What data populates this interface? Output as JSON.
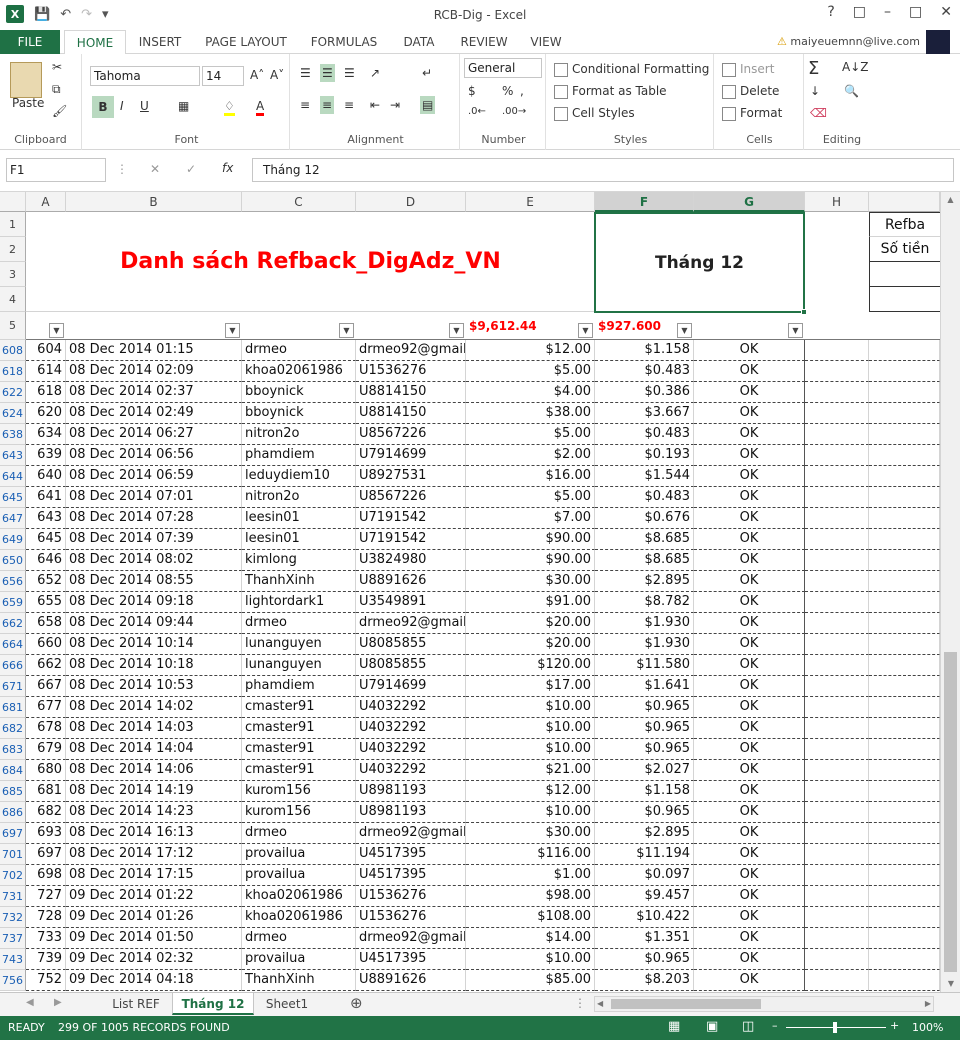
{
  "window": {
    "title": "RCB-Dig - Excel",
    "user": "maiyeuemnn@live.com"
  },
  "tabs": [
    "FILE",
    "HOME",
    "INSERT",
    "PAGE LAYOUT",
    "FORMULAS",
    "DATA",
    "REVIEW",
    "VIEW"
  ],
  "ribbon": {
    "clipboard": {
      "label": "Clipboard",
      "paste": "Paste"
    },
    "font": {
      "label": "Font",
      "name": "Tahoma",
      "size": "14"
    },
    "alignment": {
      "label": "Alignment"
    },
    "number": {
      "label": "Number",
      "format": "General"
    },
    "styles": {
      "label": "Styles",
      "conditional": "Conditional Formatting",
      "format_table": "Format as Table",
      "cell_styles": "Cell Styles"
    },
    "cells": {
      "label": "Cells",
      "insert": "Insert",
      "delete": "Delete",
      "format": "Format"
    },
    "editing": {
      "label": "Editing"
    }
  },
  "formula_bar": {
    "name_box": "F1",
    "content": "Tháng 12"
  },
  "columns": [
    "A",
    "B",
    "C",
    "D",
    "E",
    "F",
    "G",
    "H"
  ],
  "header": {
    "title": "Danh sách Refback_DigAdz_VN",
    "month": "Tháng 12",
    "side_label_1": "Refba",
    "side_label_2": "Số tiền",
    "total_e": "$9,612.44",
    "total_f": "$927.600"
  },
  "top_row_numbers": [
    "1",
    "2",
    "3",
    "4",
    "5"
  ],
  "rows": [
    {
      "r": "608",
      "a": "604",
      "b": "08 Dec 2014 01:15",
      "c": "drmeo",
      "d": "drmeo92@gmail",
      "e": "$12.00",
      "f": "$1.158",
      "g": "OK"
    },
    {
      "r": "618",
      "a": "614",
      "b": "08 Dec 2014 02:09",
      "c": "khoa02061986",
      "d": "U1536276",
      "e": "$5.00",
      "f": "$0.483",
      "g": "OK"
    },
    {
      "r": "622",
      "a": "618",
      "b": "08 Dec 2014 02:37",
      "c": "bboynick",
      "d": "U8814150",
      "e": "$4.00",
      "f": "$0.386",
      "g": "OK"
    },
    {
      "r": "624",
      "a": "620",
      "b": "08 Dec 2014 02:49",
      "c": "bboynick",
      "d": "U8814150",
      "e": "$38.00",
      "f": "$3.667",
      "g": "OK"
    },
    {
      "r": "638",
      "a": "634",
      "b": "08 Dec 2014 06:27",
      "c": "nitron2o",
      "d": "U8567226",
      "e": "$5.00",
      "f": "$0.483",
      "g": "OK"
    },
    {
      "r": "643",
      "a": "639",
      "b": "08 Dec 2014 06:56",
      "c": "phamdiem",
      "d": "U7914699",
      "e": "$2.00",
      "f": "$0.193",
      "g": "OK"
    },
    {
      "r": "644",
      "a": "640",
      "b": "08 Dec 2014 06:59",
      "c": "leduydiem10",
      "d": "U8927531",
      "e": "$16.00",
      "f": "$1.544",
      "g": "OK"
    },
    {
      "r": "645",
      "a": "641",
      "b": "08 Dec 2014 07:01",
      "c": "nitron2o",
      "d": "U8567226",
      "e": "$5.00",
      "f": "$0.483",
      "g": "OK"
    },
    {
      "r": "647",
      "a": "643",
      "b": "08 Dec 2014 07:28",
      "c": "leesin01",
      "d": "U7191542",
      "e": "$7.00",
      "f": "$0.676",
      "g": "OK"
    },
    {
      "r": "649",
      "a": "645",
      "b": "08 Dec 2014 07:39",
      "c": "leesin01",
      "d": "U7191542",
      "e": "$90.00",
      "f": "$8.685",
      "g": "OK"
    },
    {
      "r": "650",
      "a": "646",
      "b": "08 Dec 2014 08:02",
      "c": "kimlong",
      "d": "U3824980",
      "e": "$90.00",
      "f": "$8.685",
      "g": "OK"
    },
    {
      "r": "656",
      "a": "652",
      "b": "08 Dec 2014 08:55",
      "c": "ThanhXinh",
      "d": "U8891626",
      "e": "$30.00",
      "f": "$2.895",
      "g": "OK"
    },
    {
      "r": "659",
      "a": "655",
      "b": "08 Dec 2014 09:18",
      "c": "lightordark1",
      "d": "U3549891",
      "e": "$91.00",
      "f": "$8.782",
      "g": "OK"
    },
    {
      "r": "662",
      "a": "658",
      "b": "08 Dec 2014 09:44",
      "c": "drmeo",
      "d": "drmeo92@gmail",
      "e": "$20.00",
      "f": "$1.930",
      "g": "OK"
    },
    {
      "r": "664",
      "a": "660",
      "b": "08 Dec 2014 10:14",
      "c": "lunanguyen",
      "d": "U8085855",
      "e": "$20.00",
      "f": "$1.930",
      "g": "OK"
    },
    {
      "r": "666",
      "a": "662",
      "b": "08 Dec 2014 10:18",
      "c": "lunanguyen",
      "d": "U8085855",
      "e": "$120.00",
      "f": "$11.580",
      "g": "OK"
    },
    {
      "r": "671",
      "a": "667",
      "b": "08 Dec 2014 10:53",
      "c": "phamdiem",
      "d": "U7914699",
      "e": "$17.00",
      "f": "$1.641",
      "g": "OK"
    },
    {
      "r": "681",
      "a": "677",
      "b": "08 Dec 2014 14:02",
      "c": "cmaster91",
      "d": "U4032292",
      "e": "$10.00",
      "f": "$0.965",
      "g": "OK"
    },
    {
      "r": "682",
      "a": "678",
      "b": "08 Dec 2014 14:03",
      "c": "cmaster91",
      "d": "U4032292",
      "e": "$10.00",
      "f": "$0.965",
      "g": "OK"
    },
    {
      "r": "683",
      "a": "679",
      "b": "08 Dec 2014 14:04",
      "c": "cmaster91",
      "d": "U4032292",
      "e": "$10.00",
      "f": "$0.965",
      "g": "OK"
    },
    {
      "r": "684",
      "a": "680",
      "b": "08 Dec 2014 14:06",
      "c": "cmaster91",
      "d": "U4032292",
      "e": "$21.00",
      "f": "$2.027",
      "g": "OK"
    },
    {
      "r": "685",
      "a": "681",
      "b": "08 Dec 2014 14:19",
      "c": "kurom156",
      "d": "U8981193",
      "e": "$12.00",
      "f": "$1.158",
      "g": "OK"
    },
    {
      "r": "686",
      "a": "682",
      "b": "08 Dec 2014 14:23",
      "c": "kurom156",
      "d": "U8981193",
      "e": "$10.00",
      "f": "$0.965",
      "g": "OK"
    },
    {
      "r": "697",
      "a": "693",
      "b": "08 Dec 2014 16:13",
      "c": "drmeo",
      "d": "drmeo92@gmail",
      "e": "$30.00",
      "f": "$2.895",
      "g": "OK"
    },
    {
      "r": "701",
      "a": "697",
      "b": "08 Dec 2014 17:12",
      "c": "provailua",
      "d": "U4517395",
      "e": "$116.00",
      "f": "$11.194",
      "g": "OK"
    },
    {
      "r": "702",
      "a": "698",
      "b": "08 Dec 2014 17:15",
      "c": "provailua",
      "d": "U4517395",
      "e": "$1.00",
      "f": "$0.097",
      "g": "OK"
    },
    {
      "r": "731",
      "a": "727",
      "b": "09 Dec 2014 01:22",
      "c": "khoa02061986",
      "d": "U1536276",
      "e": "$98.00",
      "f": "$9.457",
      "g": "OK"
    },
    {
      "r": "732",
      "a": "728",
      "b": "09 Dec 2014 01:26",
      "c": "khoa02061986",
      "d": "U1536276",
      "e": "$108.00",
      "f": "$10.422",
      "g": "OK"
    },
    {
      "r": "737",
      "a": "733",
      "b": "09 Dec 2014 01:50",
      "c": "drmeo",
      "d": "drmeo92@gmail",
      "e": "$14.00",
      "f": "$1.351",
      "g": "OK"
    },
    {
      "r": "743",
      "a": "739",
      "b": "09 Dec 2014 02:32",
      "c": "provailua",
      "d": "U4517395",
      "e": "$10.00",
      "f": "$0.965",
      "g": "OK"
    },
    {
      "r": "756",
      "a": "752",
      "b": "09 Dec 2014 04:18",
      "c": "ThanhXinh",
      "d": "U8891626",
      "e": "$85.00",
      "f": "$8.203",
      "g": "OK"
    }
  ],
  "sheets": [
    "List REF",
    "Tháng 12",
    "Sheet1"
  ],
  "status": {
    "text": "READY",
    "records": "299 OF 1005 RECORDS FOUND",
    "zoom": "100%"
  },
  "colors": {
    "excel_green": "#217346",
    "title_red": "#ff0000"
  }
}
